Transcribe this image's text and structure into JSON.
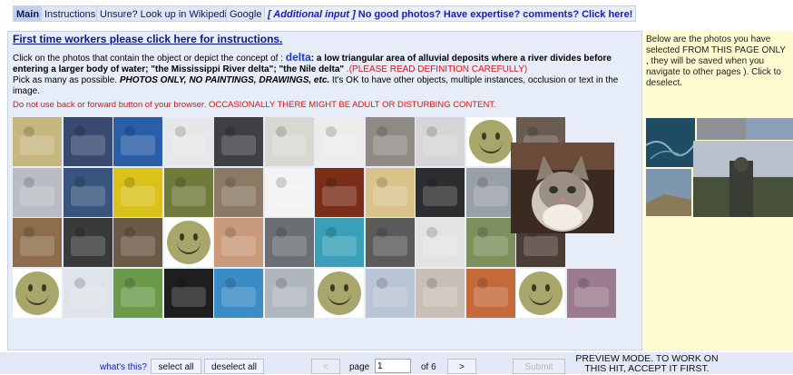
{
  "tabs": [
    "Main",
    "Instructions",
    "Unsure? Look up in Wikipedia",
    "Google"
  ],
  "tab_extra": {
    "additional": "[ Additional input ]",
    "rest": " No good photos? Have expertise? comments? Click here!"
  },
  "first_time": "First time workers please click here for instructions.",
  "instr": {
    "intro": "Click on the photos that contain the object or depict the concept of : ",
    "concept": "delta",
    "definition": ": a low triangular area of alluvial deposits where a river divides before entering a larger body of water; \"the Mississippi River delta\"; \"the Nile delta\"",
    "please": " .(PLEASE READ DEFINITION CAREFULLY)",
    "pick_a": "Pick as many as possible. ",
    "pick_b": "PHOTOS ONLY, NO PAINTINGS, DRAWINGS, etc.",
    "pick_c": " It's OK to have other objects, multiple instances, occlusion or text in the image."
  },
  "warning": "Do not use back or forward button of your browser. OCCASIONALLY THERE MIGHT BE ADULT OR DISTURBING CONTENT.",
  "sidebar": {
    "text": "Below are the photos you have selected FROM THIS PAGE ONLY , they will be saved when you navigate to other pages ). Click to deselect."
  },
  "bottom": {
    "whats": "what's this?",
    "select_all": "select all",
    "deselect_all": "deselect all",
    "prev": "<",
    "page_label": "page",
    "page_value": "1",
    "of_label": "of 6",
    "next": ">",
    "submit": "Submit",
    "preview": "PREVIEW MODE. TO WORK ON THIS HIT, ACCEPT IT FIRST."
  },
  "grid_rows": [
    [
      "#c7b77f",
      "#394a70",
      "#2a5fa8",
      "#e5e7e9",
      "#3f3f44",
      "#d8d8d2",
      "#ececec",
      "#8f8a85",
      "#d6d6d8",
      "smiley",
      "#6a5c50"
    ],
    [
      "#b9bcc2",
      "#37557e",
      "#d9c21a",
      "#6f7a3b",
      "#8c7a65",
      "#f3f3f3",
      "#7a2e1a",
      "#d9c38b",
      "#2e2e30",
      "#9aa0a8"
    ],
    [
      "#8d6d4a",
      "#3a3a3a",
      "#6b5a46",
      "smiley",
      "#c99a7a",
      "#6b6f74",
      "#39a0b8",
      "#5b5b5b",
      "#e3e3e3",
      "#7d8f5c",
      "#4a3d34"
    ],
    [
      "smiley",
      "#dfe3ea",
      "#6a9a4a",
      "#1e1e1e",
      "#3a8cc5",
      "#b0b6bd",
      "smiley",
      "#b9c4d4",
      "#c8c0b6",
      "#c46a3a",
      "smiley",
      "#9b7b8e"
    ]
  ]
}
